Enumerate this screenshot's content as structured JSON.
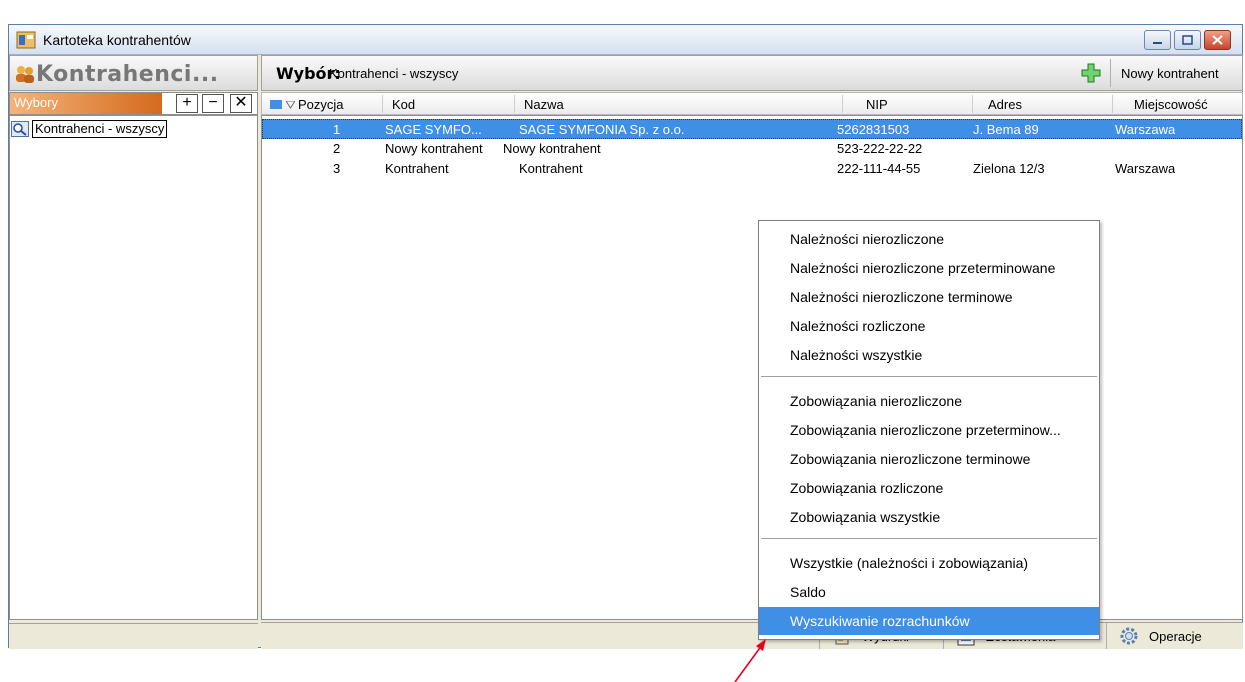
{
  "window": {
    "title": "Kartoteka kontrahentów"
  },
  "left": {
    "header": "Kontrahenci...",
    "wybory_label": "Wybory",
    "tree_item": "Kontrahenci - wszyscy"
  },
  "right": {
    "wybor_label": "Wybór:",
    "wybor_value": "Kontrahenci - wszyscy",
    "new_button": "Nowy kontrahent"
  },
  "grid": {
    "columns": [
      "Pozycja",
      "Kod",
      "Nazwa",
      "NIP",
      "Adres",
      "Miejscowość"
    ],
    "rows": [
      {
        "pos": "1",
        "kod": "SAGE SYMFO...",
        "nazwa": "SAGE SYMFONIA Sp. z o.o.",
        "nip": "5262831503",
        "adres": "J. Bema 89",
        "miasto": "Warszawa"
      },
      {
        "pos": "2",
        "kod": "Nowy kontrahent",
        "nazwa": "Nowy kontrahent",
        "nip": "523-222-22-22",
        "adres": "",
        "miasto": ""
      },
      {
        "pos": "3",
        "kod": "Kontrahent",
        "nazwa": "Kontrahent",
        "nip": "222-111-44-55",
        "adres": "Zielona 12/3",
        "miasto": "Warszawa"
      }
    ]
  },
  "bottom": {
    "wydruki": "Wydruki",
    "zestawienia": "Zestawienia",
    "operacje": "Operacje"
  },
  "menu": {
    "items": [
      "Należności nierozliczone",
      "Należności nierozliczone przeterminowane",
      "Należności nierozliczone terminowe",
      "Należności rozliczone",
      "Należności wszystkie",
      "Zobowiązania nierozliczone",
      "Zobowiązania nierozliczone przeterminow...",
      "Zobowiązania nierozliczone terminowe",
      "Zobowiązania rozliczone",
      "Zobowiązania wszystkie",
      "Wszystkie (należności i zobowiązania)",
      "Saldo",
      "Wyszukiwanie rozrachunków"
    ],
    "highlighted_index": 12
  },
  "colors": {
    "selection": "#3f8fe6",
    "accent": "#d46a1e",
    "arrow": "#e8001c"
  }
}
